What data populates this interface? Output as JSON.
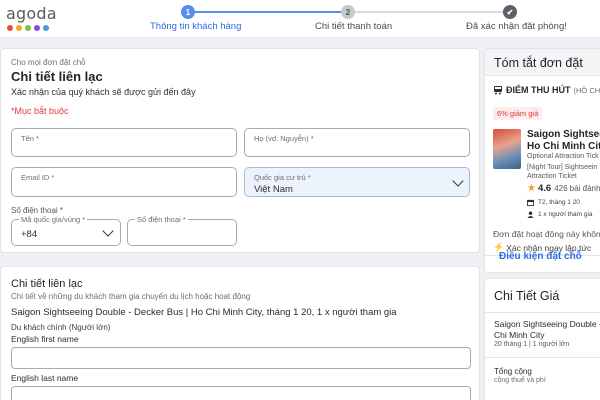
{
  "header": {
    "logo_text": "agoda",
    "logo_colors": [
      "#e84b37",
      "#f6a623",
      "#7cc142",
      "#8a4bd8",
      "#3ea0e0"
    ],
    "steps": [
      {
        "number": "1",
        "label": "Thông tin khách hàng",
        "state": "active"
      },
      {
        "number": "2",
        "label": "Chi tiết thanh toán",
        "state": "inactive"
      },
      {
        "number": "✔",
        "label": "Đã xác nhận đặt phòng!",
        "state": "last"
      }
    ]
  },
  "contact": {
    "kicker": "Cho mọi đơn đặt chỗ",
    "title": "Chi tiết liên lạc",
    "subtitle": "Xác nhận của quý khách sẽ được gửi đến đây",
    "required_note": "*Mục bắt buộc",
    "first_name_label": "Tên *",
    "last_name_label": "Họ (vd: Nguyễn) *",
    "email_label": "Email ID *",
    "country_label": "Quốc gia cư trú *",
    "country_value": "Việt Nam",
    "phone_section_label": "Số điện thoại *",
    "country_code_label": "Mã quốc gia/vùng *",
    "country_code_value": "+84",
    "phone_label": "Số điện thoại *"
  },
  "participants": {
    "title": "Chi tiết liên lạc",
    "subtitle": "Chi tiết về những du khách tham gia chuyến du lịch hoặc hoạt động",
    "activity": "Saigon Sightseeing Double - Decker Bus | Ho Chi Minh City, tháng 1 20, 1 x người tham gia",
    "main_traveler": "Du khách chính (Người lớn)",
    "first_name_label": "English first name",
    "last_name_label": "English last name"
  },
  "summary": {
    "title": "Tóm tắt đơn đặt",
    "category": "ĐIỂM THU HÚT",
    "location": "(HỒ CHÍ M",
    "discount": "6% giảm giá",
    "name_line1": "Saigon Sightseeing",
    "name_line2": "Ho Chi Minh City",
    "name_line3": "Optional Attraction Tick",
    "tour_line1": "[Night Tour] Sightseein",
    "tour_line2": "Attraction Ticket",
    "rating": "4.6",
    "reviews": "426 bài đánh",
    "date": "T2, tháng 1 20",
    "guests": "1 x người tham gia",
    "operated_by": "Đơn đặt hoạt động này không",
    "instant_confirm": "Xác nhận ngay lập tức",
    "conditions_link": "Điều kiện đặt chỗ"
  },
  "price": {
    "title": "Chi Tiết Giá",
    "item_line1": "Saigon Sightseeing Double - D",
    "item_line2": "Chi Minh City",
    "item_meta": "20 tháng 1 | 1 người lớn",
    "total_label": "Tổng cộng",
    "tax_note": "cộng thuế và phí"
  },
  "icons": {
    "bus": "bus-icon",
    "calendar": "calendar-icon",
    "user": "user-icon",
    "bolt": "lightning-icon",
    "chevron": "chevron-down-icon"
  }
}
